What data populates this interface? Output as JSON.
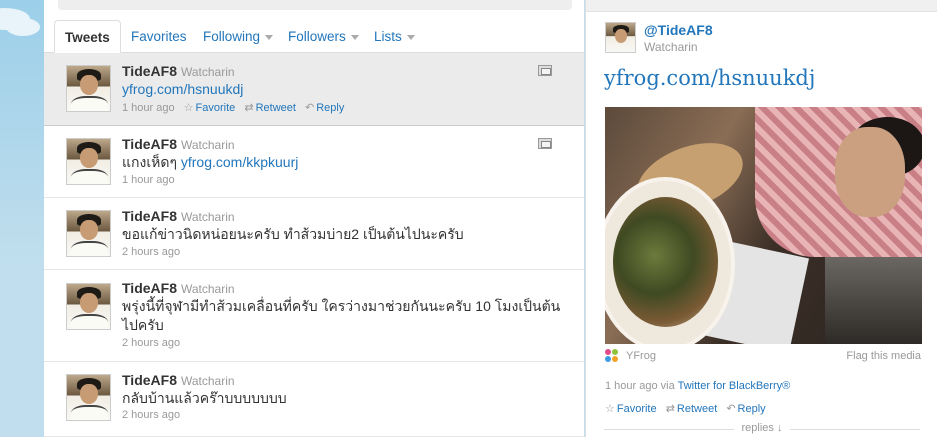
{
  "tabs": [
    {
      "label": "Tweets",
      "active": true
    },
    {
      "label": "Favorites",
      "dropdown": false
    },
    {
      "label": "Following",
      "dropdown": true
    },
    {
      "label": "Followers",
      "dropdown": true
    },
    {
      "label": "Lists",
      "dropdown": true
    }
  ],
  "tweets": [
    {
      "username": "TideAF8",
      "fullname": "Watcharin",
      "text": "",
      "link": "yfrog.com/hsnuukdj",
      "time": "1 hour ago",
      "has_media": true,
      "selected": true,
      "actions": {
        "favorite": "Favorite",
        "retweet": "Retweet",
        "reply": "Reply"
      }
    },
    {
      "username": "TideAF8",
      "fullname": "Watcharin",
      "text": "แกงเห็ดๆ ",
      "link": "yfrog.com/kkpkuurj",
      "time": "1 hour ago",
      "has_media": true
    },
    {
      "username": "TideAF8",
      "fullname": "Watcharin",
      "text": "ขอแก้ข่าวนิดหน่อยนะครับ ทำส้วมบ่าย2 เป็นต้นไปนะครับ",
      "time": "2 hours ago"
    },
    {
      "username": "TideAF8",
      "fullname": "Watcharin",
      "text": "พรุ่งนี้ที่จุฬามีทำส้วมเคลื่อนที่ครับ ใครว่างมาช่วยกันนะครับ 10 โมงเป็นต้นไปครับ",
      "time": "2 hours ago"
    },
    {
      "username": "TideAF8",
      "fullname": "Watcharin",
      "text": "กลับบ้านแล้วคร๊าบบบบบบบ",
      "time": "2 hours ago"
    }
  ],
  "panel": {
    "handle": "@TideAF8",
    "fullname": "Watcharin",
    "link": "yfrog.com/hsnuukdj",
    "source": "YFrog",
    "flag": "Flag this media",
    "meta_time": "1 hour ago",
    "meta_via": "via",
    "meta_client": "Twitter for BlackBerry®",
    "actions": {
      "favorite": "Favorite",
      "retweet": "Retweet",
      "reply": "Reply"
    },
    "replies": "replies ↓"
  },
  "colors": {
    "link": "#2276bb",
    "muted": "#999999",
    "background": "#c0deed",
    "selected_row": "#ebebeb"
  },
  "icons": {
    "favorite": "star-icon",
    "retweet": "retweet-icon",
    "reply": "reply-arrow-icon",
    "media": "media-icon",
    "source": "yfrog-logo-icon"
  }
}
